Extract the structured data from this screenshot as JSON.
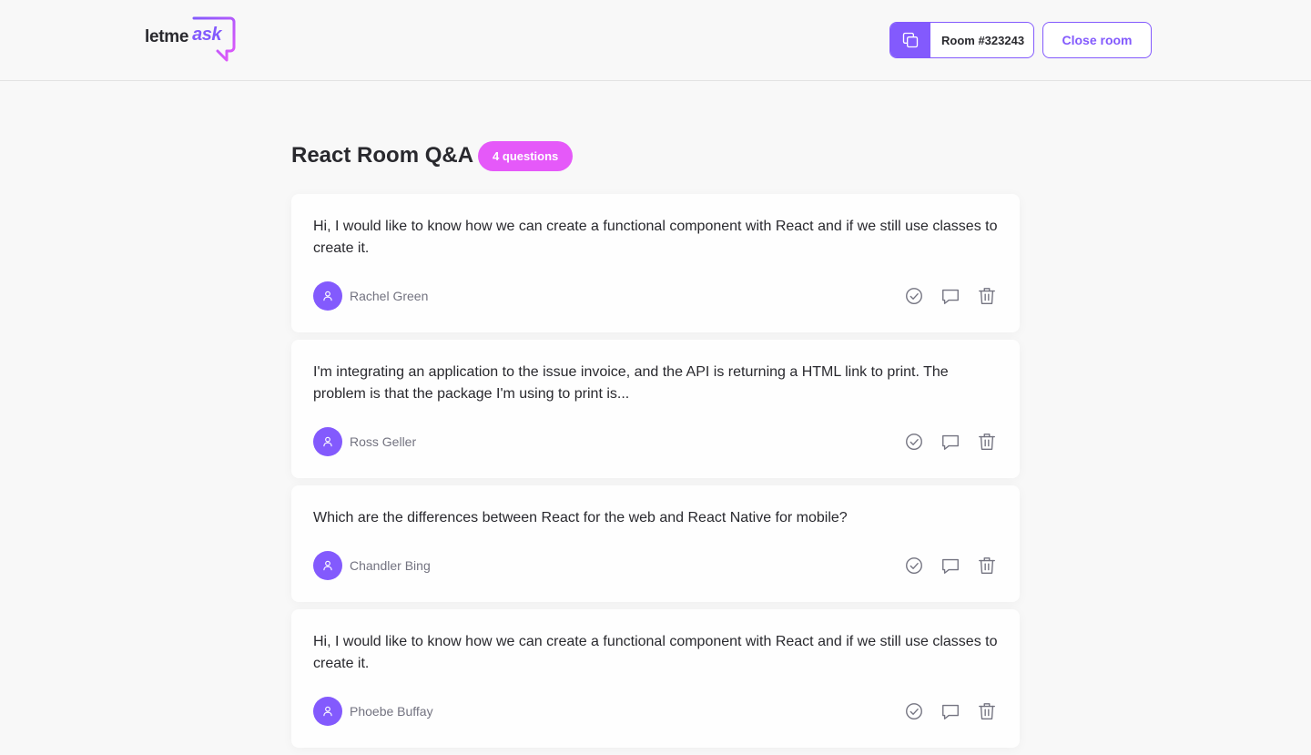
{
  "header": {
    "logo_text": "letme",
    "logo_accent": "ask",
    "room_code_label": "Room #323243",
    "close_button": "Close room"
  },
  "room": {
    "title": "React Room Q&A",
    "question_count": "4 questions"
  },
  "questions": [
    {
      "content": "Hi, I would like to know how we can create a functional component with React and if we still use classes to create it.",
      "author": "Rachel Green"
    },
    {
      "content": "I'm integrating an application to the issue invoice, and the API is returning a HTML link to print. The problem is that the package I'm using to print is...",
      "author": "Ross Geller"
    },
    {
      "content": "Which are the differences between React for the web and React Native for mobile?",
      "author": "Chandler Bing"
    },
    {
      "content": "Hi, I would like to know how we can create a functional component with React and if we still use classes to create it.",
      "author": "Phoebe Buffay"
    }
  ],
  "icons": {
    "copy": "copy-icon",
    "user": "user-icon",
    "check": "check-circle-icon",
    "answer": "chat-bubble-icon",
    "delete": "trash-icon"
  },
  "colors": {
    "primary": "#835afd",
    "badge": "#e559f9",
    "background": "#f8f8f8"
  }
}
